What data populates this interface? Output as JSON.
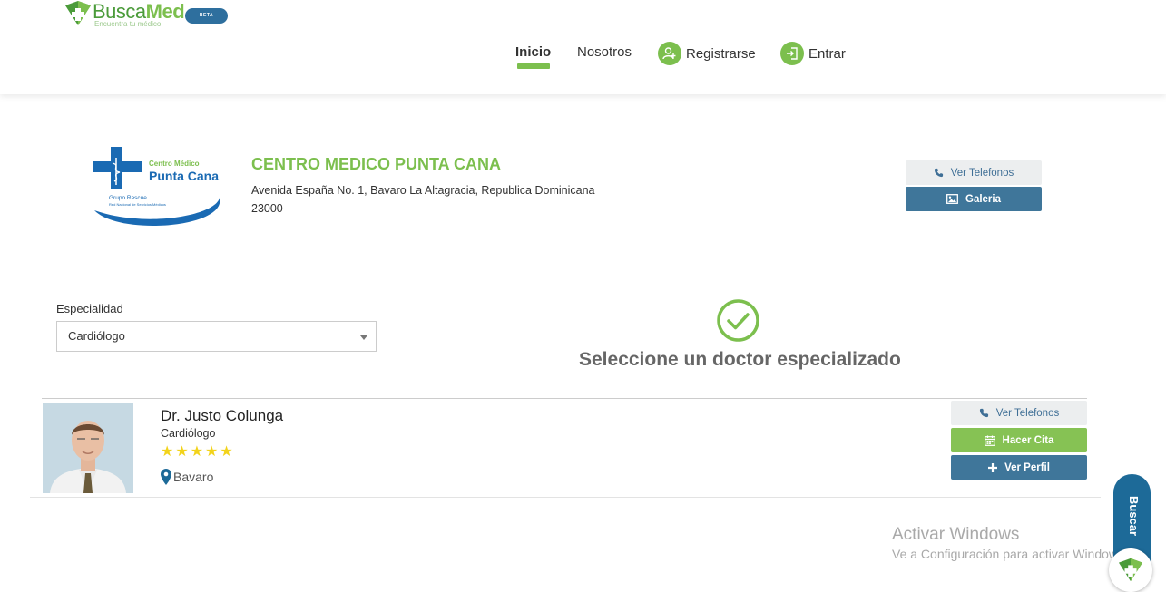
{
  "brand": {
    "name_part1": "Busca",
    "name_part2": "Med",
    "tagline": "Encuentra tu médico",
    "badge": "BETA",
    "colors": {
      "green": "#7cbf4e",
      "blue": "#3f769a"
    }
  },
  "nav": {
    "inicio": "Inicio",
    "nosotros": "Nosotros",
    "registrarse": "Registrarse",
    "entrar": "Entrar"
  },
  "clinic": {
    "logo_title": "Centro Médico",
    "logo_name": "Punta Cana",
    "logo_group": "Grupo Rescue",
    "logo_subtitle": "Red Nacional de Servicios Médicos",
    "name": "CENTRO MEDICO PUNTA CANA",
    "address": "Avenida España No. 1, Bavaro La Altagracia, Republica Dominicana",
    "zip": "23000",
    "phones_label": "Ver Telefonos",
    "gallery_label": "Galeria"
  },
  "filter": {
    "label": "Especialidad",
    "selected": "Cardiólogo"
  },
  "message": "Seleccione un doctor especializado",
  "doctor": {
    "name": "Dr. Justo Colunga",
    "specialty": "Cardiólogo",
    "rating": 5,
    "location": "Bavaro",
    "phones_label": "Ver Telefonos",
    "cita_label": "Hacer Cita",
    "perfil_label": "Ver Perfil"
  },
  "side_tab": "Buscar",
  "watermark": {
    "title": "Activar Windows",
    "subtitle": "Ve a Configuración para activar Windows."
  }
}
